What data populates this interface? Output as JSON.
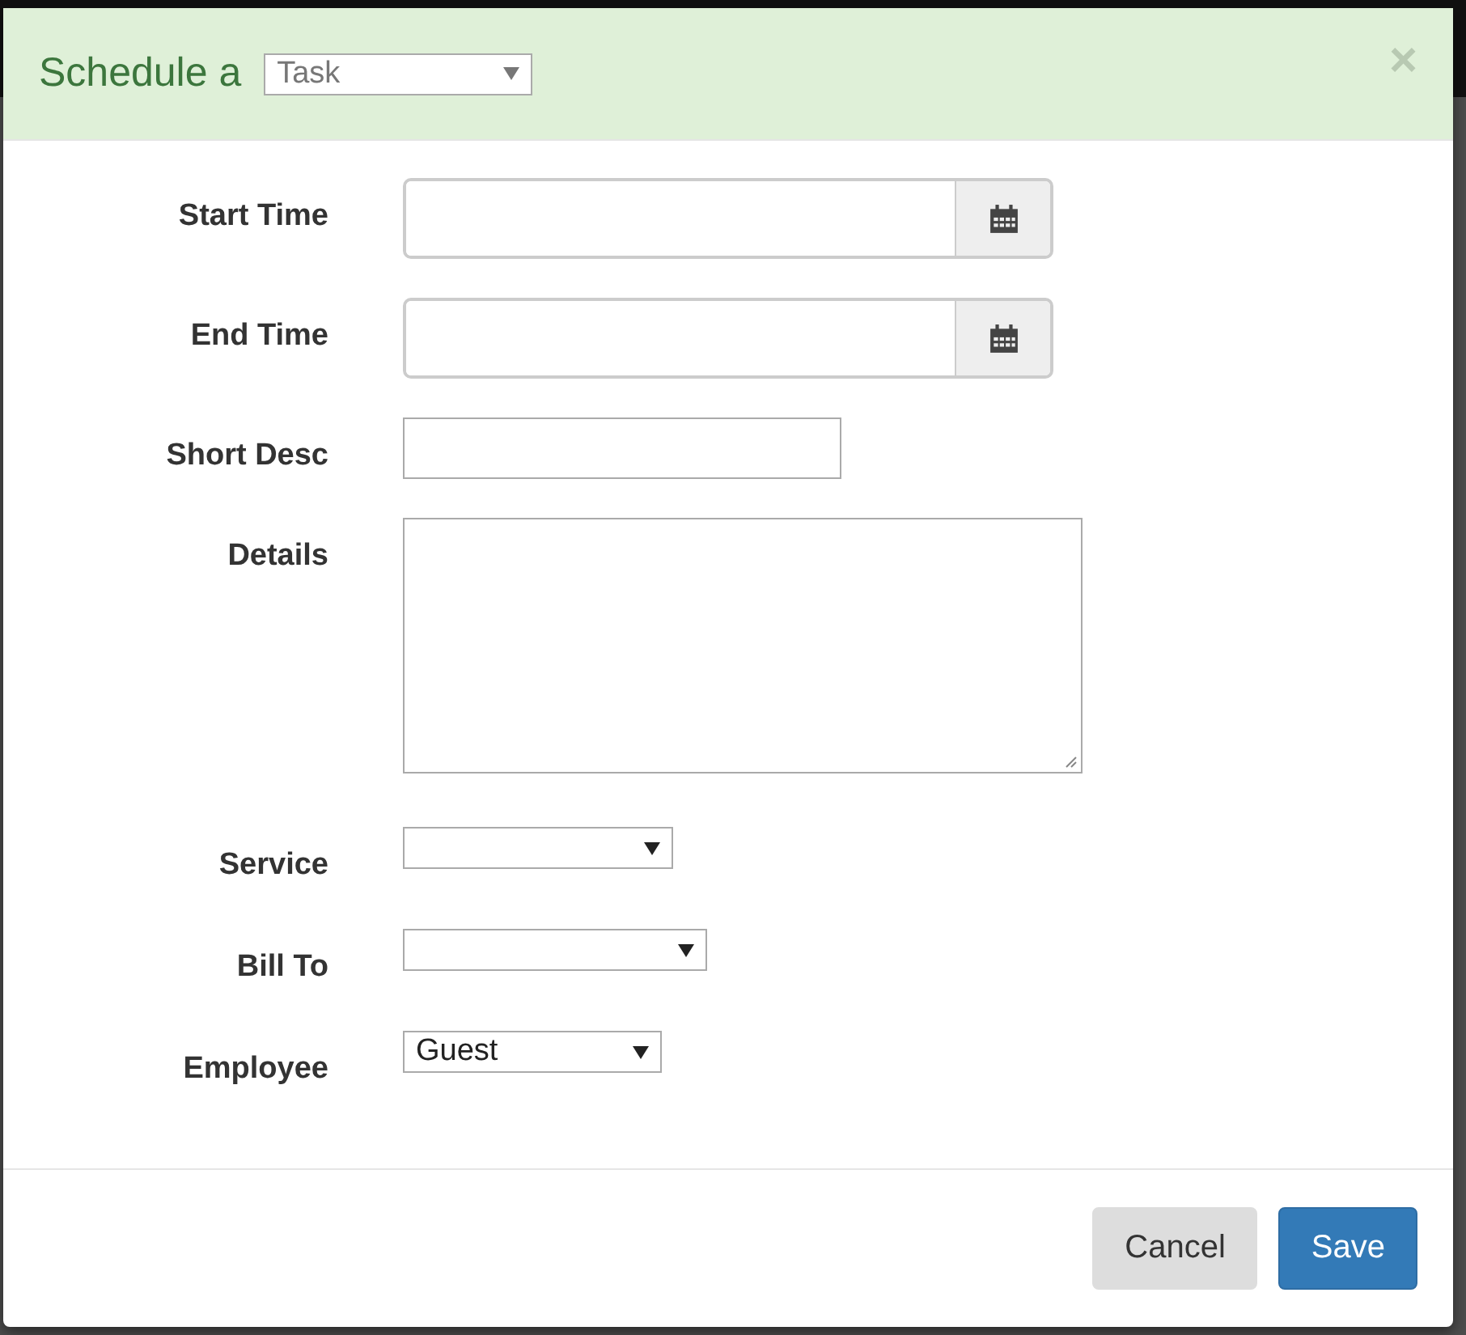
{
  "dialog": {
    "title": "Schedule a",
    "type_select": {
      "value": "Task"
    },
    "close": "×"
  },
  "fields": [
    {
      "kind": "datetime",
      "label": "Start Time"
    },
    {
      "kind": "datetime",
      "label": "End Time"
    },
    {
      "kind": "text",
      "label": "Short Desc"
    },
    {
      "kind": "textarea",
      "label": "Details"
    },
    {
      "kind": "select",
      "label": "Service"
    },
    {
      "kind": "select",
      "label": "Bill To"
    },
    {
      "kind": "select",
      "label": "Employee",
      "value": "Guest"
    }
  ],
  "buttons": [
    {
      "label": "Cancel",
      "kind": "default"
    },
    {
      "label": "Save",
      "kind": "primary"
    }
  ]
}
